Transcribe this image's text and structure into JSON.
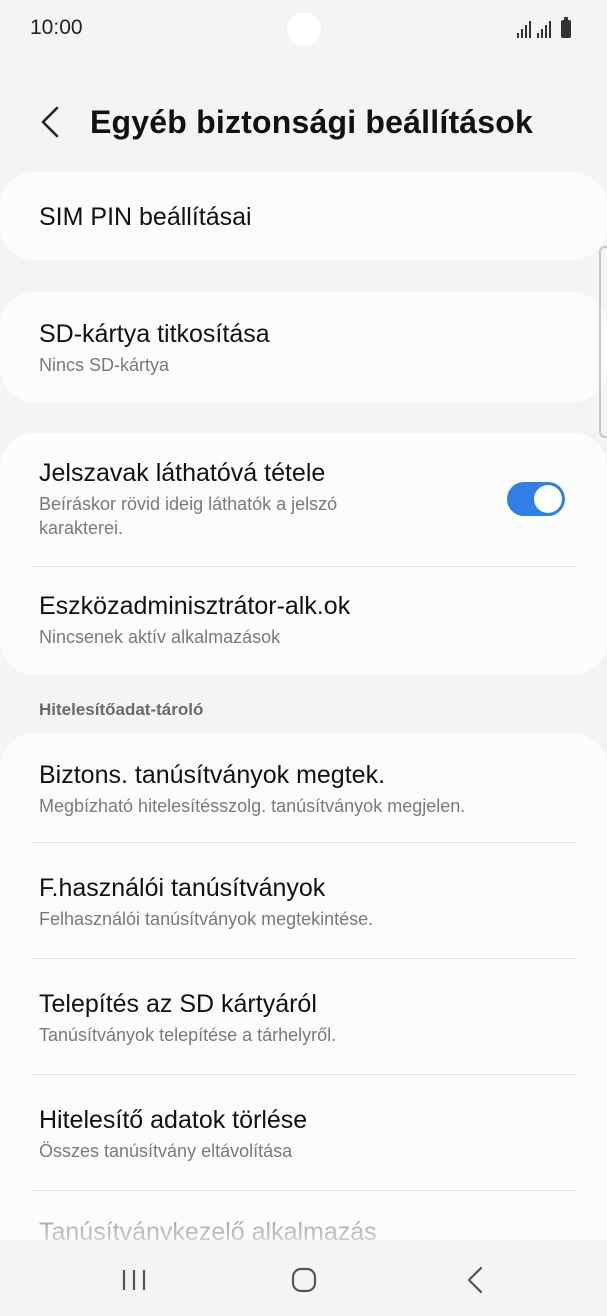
{
  "status_bar": {
    "time": "10:00"
  },
  "header": {
    "title": "Egyéb biztonsági beállítások"
  },
  "items": {
    "sim_pin": {
      "title": "SIM PIN beállításai"
    },
    "sd_encrypt": {
      "title": "SD-kártya titkosítása",
      "subtitle": "Nincs SD-kártya"
    },
    "show_passwords": {
      "title": "Jelszavak láthatóvá tétele",
      "subtitle": "Beíráskor rövid ideig láthatók a jelszó karakterei.",
      "enabled": true
    },
    "device_admin": {
      "title": "Eszközadminisztrátor-alk.ok",
      "subtitle": "Nincsenek aktív alkalmazások"
    },
    "trusted_certs": {
      "title": "Biztons. tanúsítványok megtek.",
      "subtitle": "Megbízható hitelesítésszolg. tanúsítványok megjelen."
    },
    "user_certs": {
      "title": "F.használói tanúsítványok",
      "subtitle": "Felhasználói tanúsítványok megtekintése."
    },
    "install_sd": {
      "title": "Telepítés az SD kártyáról",
      "subtitle": "Tanúsítványok telepítése a tárhelyről."
    },
    "clear_credentials": {
      "title": "Hitelesítő adatok törlése",
      "subtitle": "Összes tanúsítvány eltávolítása"
    },
    "cert_manager": {
      "title": "Tanúsítványkezelő alkalmazás"
    }
  },
  "sections": {
    "credential_storage": "Hitelesítőadat-tároló"
  },
  "colors": {
    "accent": "#2f7fe6",
    "background": "#f4f4f4",
    "card": "#fcfcfc"
  }
}
